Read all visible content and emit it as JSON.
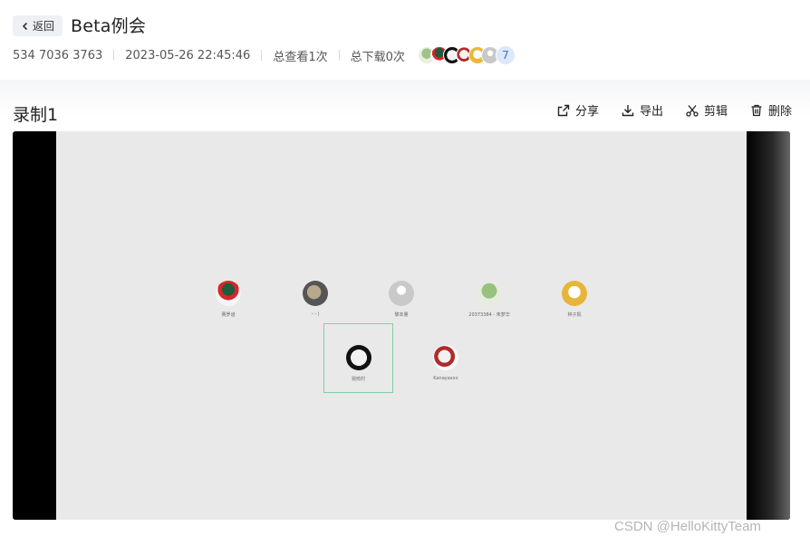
{
  "header": {
    "back_label": "返回",
    "title": "Beta例会",
    "meeting_id": "534 7036 3763",
    "datetime": "2023-05-26 22:45:46",
    "views": "总查看1次",
    "downloads": "总下载0次",
    "participant_count": "7"
  },
  "recording": {
    "title": "录制1",
    "actions": {
      "share": "分享",
      "export": "导出",
      "edit": "剪辑",
      "delete": "删除"
    }
  },
  "participants": [
    {
      "name": "赛罗谜",
      "icon": "avatar-red-green"
    },
    {
      "name": "‹ › |",
      "icon": "avatar-gray-book"
    },
    {
      "name": "黎本量",
      "icon": "avatar-default"
    },
    {
      "name": "20373384 - 朱梦华",
      "icon": "avatar-figurine"
    },
    {
      "name": "林子凯",
      "icon": "avatar-cartoon"
    },
    {
      "name": "Kanayaxxx",
      "icon": "avatar-anime"
    }
  ],
  "active_speaker": {
    "name": "昆鸣村",
    "icon": "avatar-sketch"
  },
  "watermark": "CSDN @HelloKittyTeam",
  "colors": {
    "accent": "#3b6fd8",
    "speaker_border": "#7fcfa9"
  }
}
